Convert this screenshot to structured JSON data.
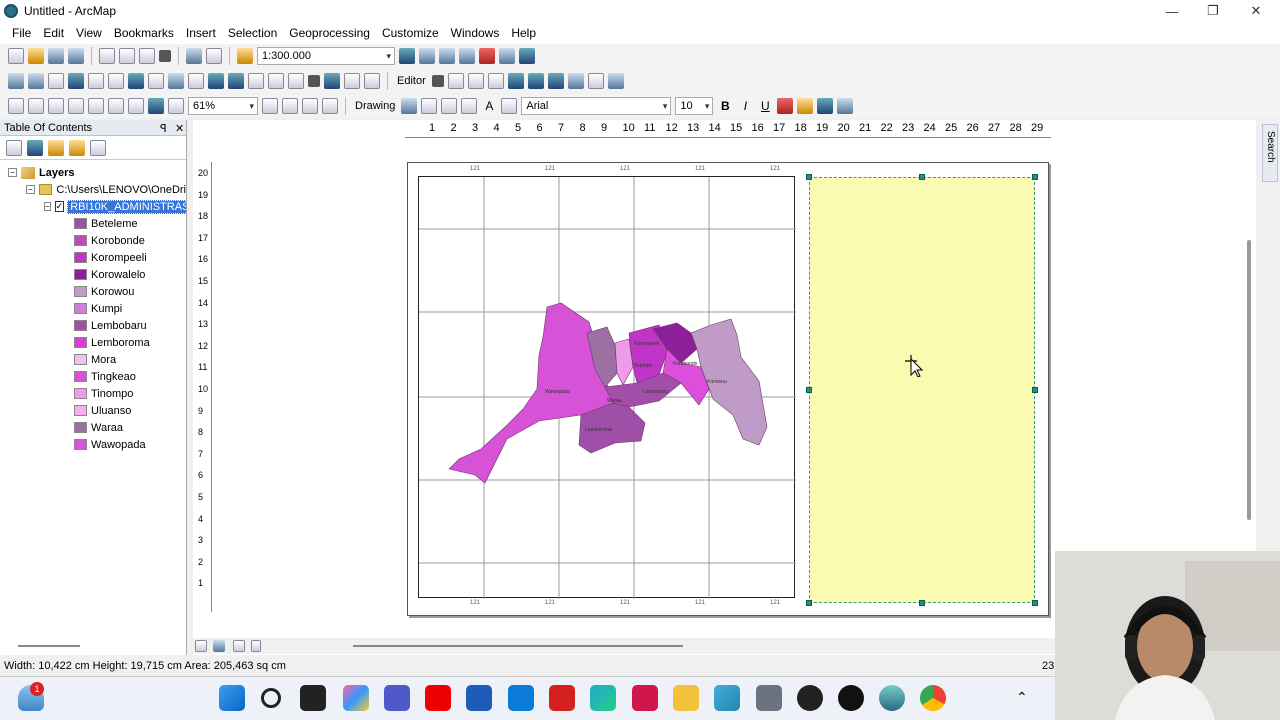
{
  "window": {
    "title": "Untitled - ArcMap",
    "min": "—",
    "restore": "❐",
    "close": "✕"
  },
  "menu": [
    "File",
    "Edit",
    "View",
    "Bookmarks",
    "Insert",
    "Selection",
    "Geoprocessing",
    "Customize",
    "Windows",
    "Help"
  ],
  "toolbar": {
    "scale": "1:300.000",
    "zoom": "61%",
    "editor_label": "Editor",
    "drawing_label": "Drawing",
    "font": "Arial",
    "font_size": "10",
    "bold": "B",
    "italic": "I",
    "underline": "U",
    "text_tool": "A"
  },
  "toc": {
    "title": "Table Of Contents",
    "pin": "ꟼ",
    "close": "✕",
    "root": "Layers",
    "folder": "C:\\Users\\LENOVO\\OneDri",
    "layer": "RBI10K_ADMINISTRAS",
    "items": [
      {
        "label": "Beteleme",
        "color": "#a04fa8"
      },
      {
        "label": "Korobonde",
        "color": "#b94db3"
      },
      {
        "label": "Korompeeli",
        "color": "#c035c8"
      },
      {
        "label": "Korowalelo",
        "color": "#8e1f9a"
      },
      {
        "label": "Korowou",
        "color": "#c19bc8"
      },
      {
        "label": "Kumpi",
        "color": "#d07fd6"
      },
      {
        "label": "Lembobaru",
        "color": "#a34ea8"
      },
      {
        "label": "Lemboroma",
        "color": "#d63ed6"
      },
      {
        "label": "Mora",
        "color": "#f0c2ec"
      },
      {
        "label": "Tingkeao",
        "color": "#dc4fdc"
      },
      {
        "label": "Tinompo",
        "color": "#ee9ce8"
      },
      {
        "label": "Uluanso",
        "color": "#f2b0f0"
      },
      {
        "label": "Waraa",
        "color": "#9d6fa2"
      },
      {
        "label": "Wawopada",
        "color": "#da52da"
      }
    ]
  },
  "ruler": {
    "h": [
      "1",
      "2",
      "3",
      "4",
      "5",
      "6",
      "7",
      "8",
      "9",
      "10",
      "11",
      "12",
      "13",
      "14",
      "15",
      "16",
      "17",
      "18",
      "19",
      "20",
      "21",
      "22",
      "23",
      "24",
      "25",
      "26",
      "27",
      "28",
      "29"
    ],
    "v": [
      "20",
      "19",
      "18",
      "17",
      "16",
      "15",
      "14",
      "13",
      "12",
      "11",
      "10",
      "9",
      "8",
      "7",
      "6",
      "5",
      "4",
      "3",
      "2",
      "1"
    ]
  },
  "map": {
    "coord_label": "121",
    "villages": [
      "Wawopada",
      "Waraa",
      "Tinompo",
      "Korompeeli",
      "Korowou",
      "Korobonde",
      "Lembobaru",
      "Lemboroma"
    ]
  },
  "search_tab": "Search",
  "status": {
    "text": "Width: 10,422 cm  Height: 19,715 cm  Area: 205,463 sq cm",
    "right": "23"
  },
  "taskbar": {
    "badge": "1"
  }
}
